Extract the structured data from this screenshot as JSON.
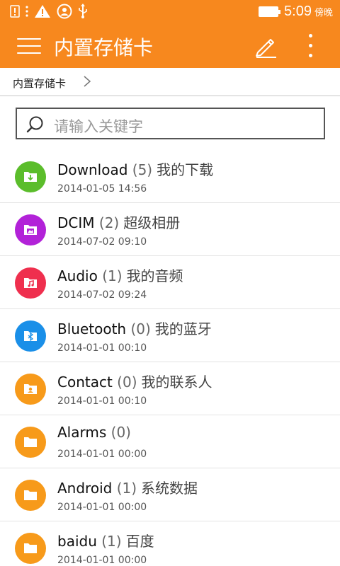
{
  "status_bar": {
    "time": "5:09",
    "period": "傍晚",
    "icons": [
      "notification-icon",
      "more-notifications-icon",
      "warning-icon",
      "remote-icon",
      "usb-icon",
      "battery-icon"
    ]
  },
  "toolbar": {
    "title": "内置存储卡",
    "background": "#f7881e"
  },
  "breadcrumb": {
    "items": [
      "内置存储卡"
    ]
  },
  "search": {
    "placeholder": "请输入关键字"
  },
  "folders": [
    {
      "name": "Download",
      "count": "(5)",
      "desc": "我的下载",
      "date": "2014-01-05 14:56",
      "icon": "download-folder-icon",
      "color": "#5bbd2b"
    },
    {
      "name": "DCIM",
      "count": "(2)",
      "desc": "超级相册",
      "date": "2014-07-02 09:10",
      "icon": "photo-folder-icon",
      "color": "#b222d8"
    },
    {
      "name": "Audio",
      "count": "(1)",
      "desc": "我的音频",
      "date": "2014-07-02 09:24",
      "icon": "music-folder-icon",
      "color": "#ef2f4e"
    },
    {
      "name": "Bluetooth",
      "count": "(0)",
      "desc": "我的蓝牙",
      "date": "2014-01-01 00:10",
      "icon": "bluetooth-folder-icon",
      "color": "#1a8fe8"
    },
    {
      "name": "Contact",
      "count": "(0)",
      "desc": "我的联系人",
      "date": "2014-01-01 00:10",
      "icon": "contact-folder-icon",
      "color": "#f79a1a"
    },
    {
      "name": "Alarms",
      "count": "(0)",
      "desc": "",
      "date": "2014-01-01 00:00",
      "icon": "folder-icon",
      "color": "#f79a1a"
    },
    {
      "name": "Android",
      "count": "(1)",
      "desc": "系统数据",
      "date": "2014-01-01 00:00",
      "icon": "folder-icon",
      "color": "#f79a1a"
    },
    {
      "name": "baidu",
      "count": "(1)",
      "desc": "百度",
      "date": "2014-01-01 00:00",
      "icon": "folder-icon",
      "color": "#f79a1a"
    }
  ]
}
